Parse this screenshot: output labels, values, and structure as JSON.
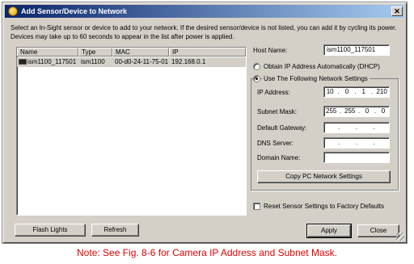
{
  "window": {
    "title": "Add Sensor/Device to Network",
    "close_glyph": "✕"
  },
  "instructions": "Select an In-Sight sensor or device to add to your network.  If the desired sensor/device is not listed, you can add it by cycling its power. Devices may take up to 60 seconds to appear in the list after power is applied.",
  "device_list": {
    "columns": [
      "Name",
      "Type",
      "MAC",
      "IP"
    ],
    "rows": [
      {
        "name": "ism1100_117501",
        "type": "ism1100",
        "mac": "00-d0-24-11-75-01",
        "ip": "192.168.0.1"
      }
    ]
  },
  "network": {
    "host_name_label": "Host Name:",
    "host_name_value": "ism1100_117501",
    "dhcp_label": "Obtain IP Address Automatically (DHCP)",
    "static_label": "Use The Following Network Settings",
    "selected_mode": "static",
    "ip_label": "IP Address:",
    "ip_value": [
      "10",
      "0",
      "1",
      "210"
    ],
    "subnet_label": "Subnet Mask:",
    "subnet_value": [
      "255",
      "255",
      "0",
      "0"
    ],
    "gateway_label": "Default Gateway:",
    "dns_label": "DNS Server:",
    "domain_label": "Domain Name:",
    "empty_ip_dots": [
      ".",
      ".",
      "."
    ],
    "copy_pc_label": "Copy PC Network Settings"
  },
  "reset_label": "Reset Sensor Settings to Factory Defaults",
  "buttons": {
    "flash_lights": "Flash Lights",
    "refresh": "Refresh",
    "apply": "Apply",
    "close": "Close"
  },
  "note": "Note: See Fig. 8-6 for Camera IP Address and Subnet Mask.",
  "colors": {
    "title_start": "#0a246a",
    "title_end": "#a6caf0",
    "note": "#e00000",
    "dialog_face": "#d4d0c8"
  }
}
